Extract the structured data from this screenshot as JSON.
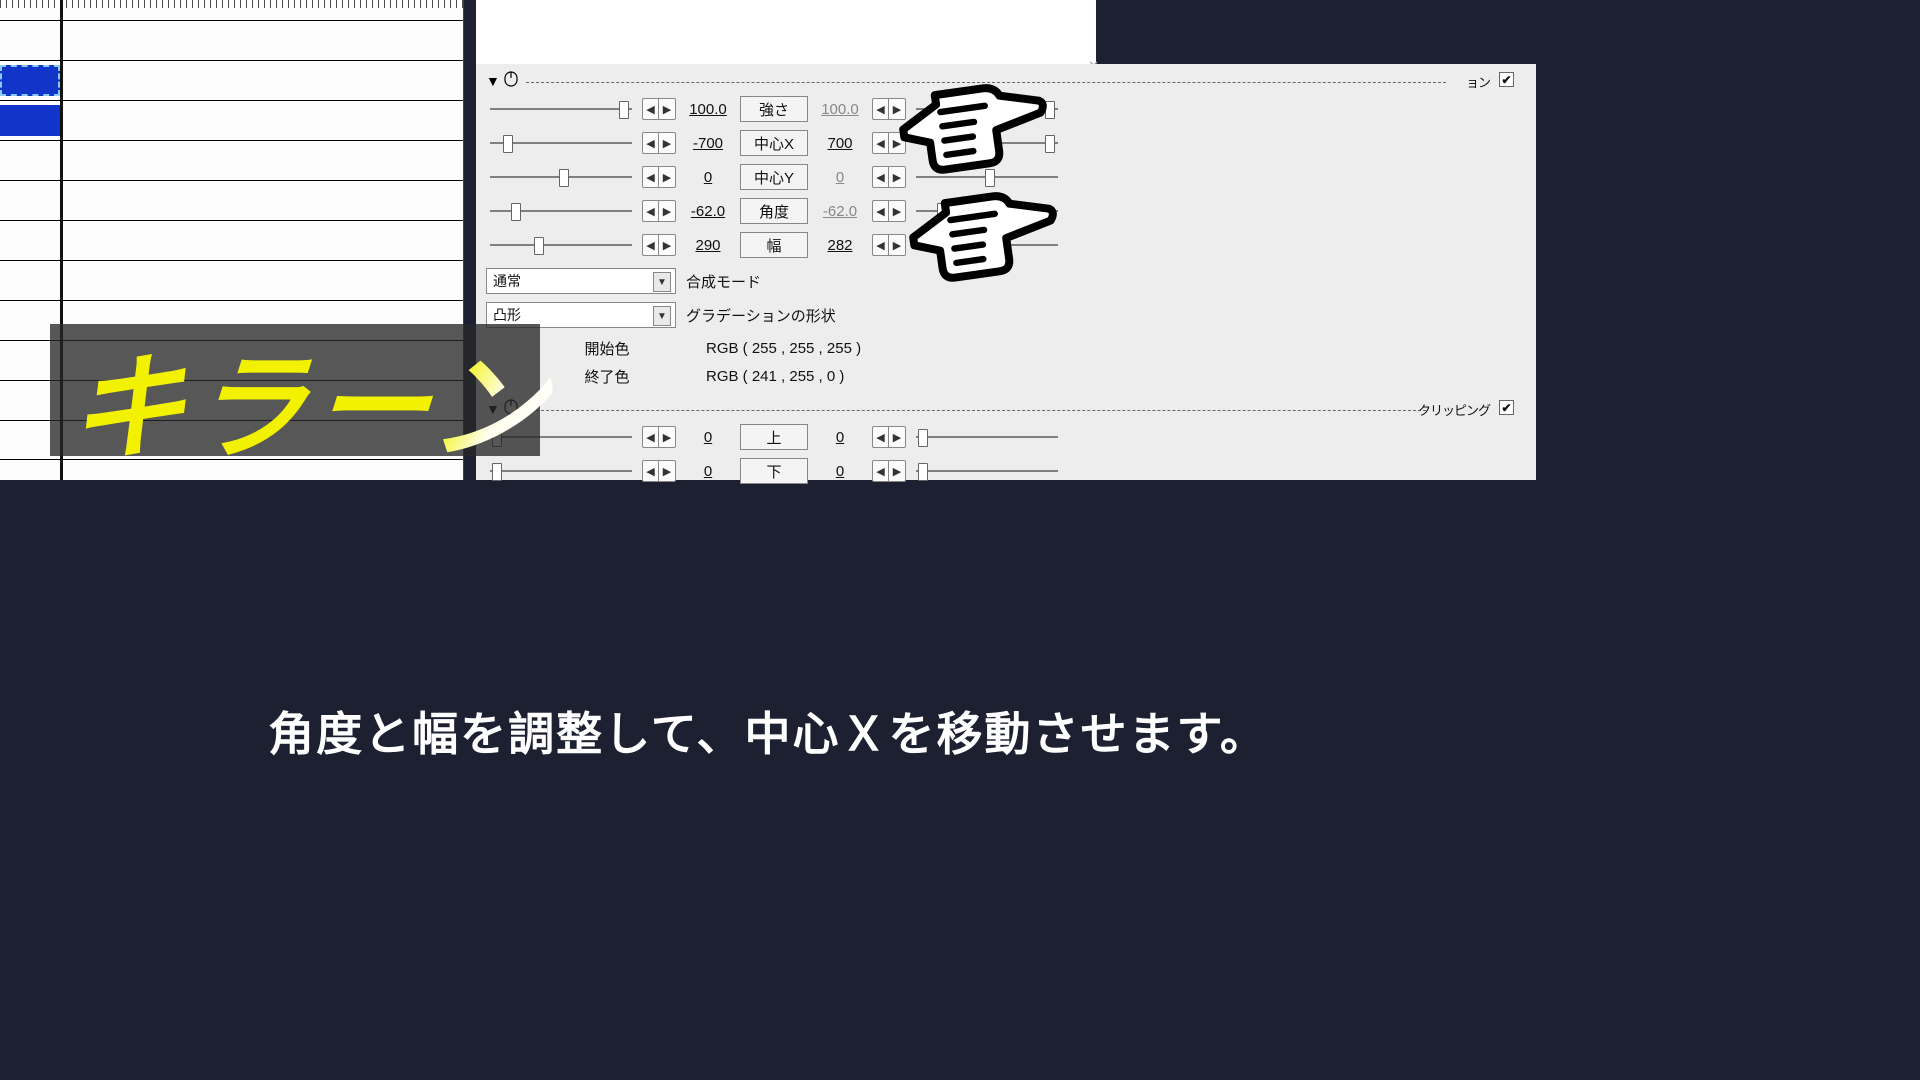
{
  "gradient": {
    "section_checkbox_label": "ョン",
    "params": [
      {
        "label": "強さ",
        "v1": "100.0",
        "v2": "100.0",
        "t1": 95,
        "t2": 95,
        "dim2": true
      },
      {
        "label": "中心X",
        "v1": "-700",
        "v2": "700",
        "t1": 12,
        "t2": 95
      },
      {
        "label": "中心Y",
        "v1": "0",
        "v2": "0",
        "t1": 52,
        "t2": 52,
        "dim2": true
      },
      {
        "label": "角度",
        "v1": "-62.0",
        "v2": "-62.0",
        "t1": 18,
        "t2": 18,
        "dim2": true
      },
      {
        "label": "幅",
        "v1": "290",
        "v2": "282",
        "t1": 34,
        "t2": 32
      }
    ],
    "blend_mode": {
      "value": "通常",
      "label": "合成モード"
    },
    "shape": {
      "value": "凸形",
      "label": "グラデーションの形状"
    },
    "start_color": {
      "label": "開始色",
      "value": "RGB ( 255 , 255 , 255 )"
    },
    "end_color": {
      "label": "終了色",
      "value": "RGB ( 241 , 255 , 0 )"
    }
  },
  "clipping": {
    "label": "クリッピング",
    "params": [
      {
        "label": "上",
        "v1": "0",
        "v2": "0",
        "t1": 4,
        "t2": 4
      },
      {
        "label": "下",
        "v1": "0",
        "v2": "0",
        "t1": 4,
        "t2": 4
      }
    ]
  },
  "overlay_text": "キラーン",
  "caption": "角度と幅を調整して、中心Ｘを移動させます。"
}
